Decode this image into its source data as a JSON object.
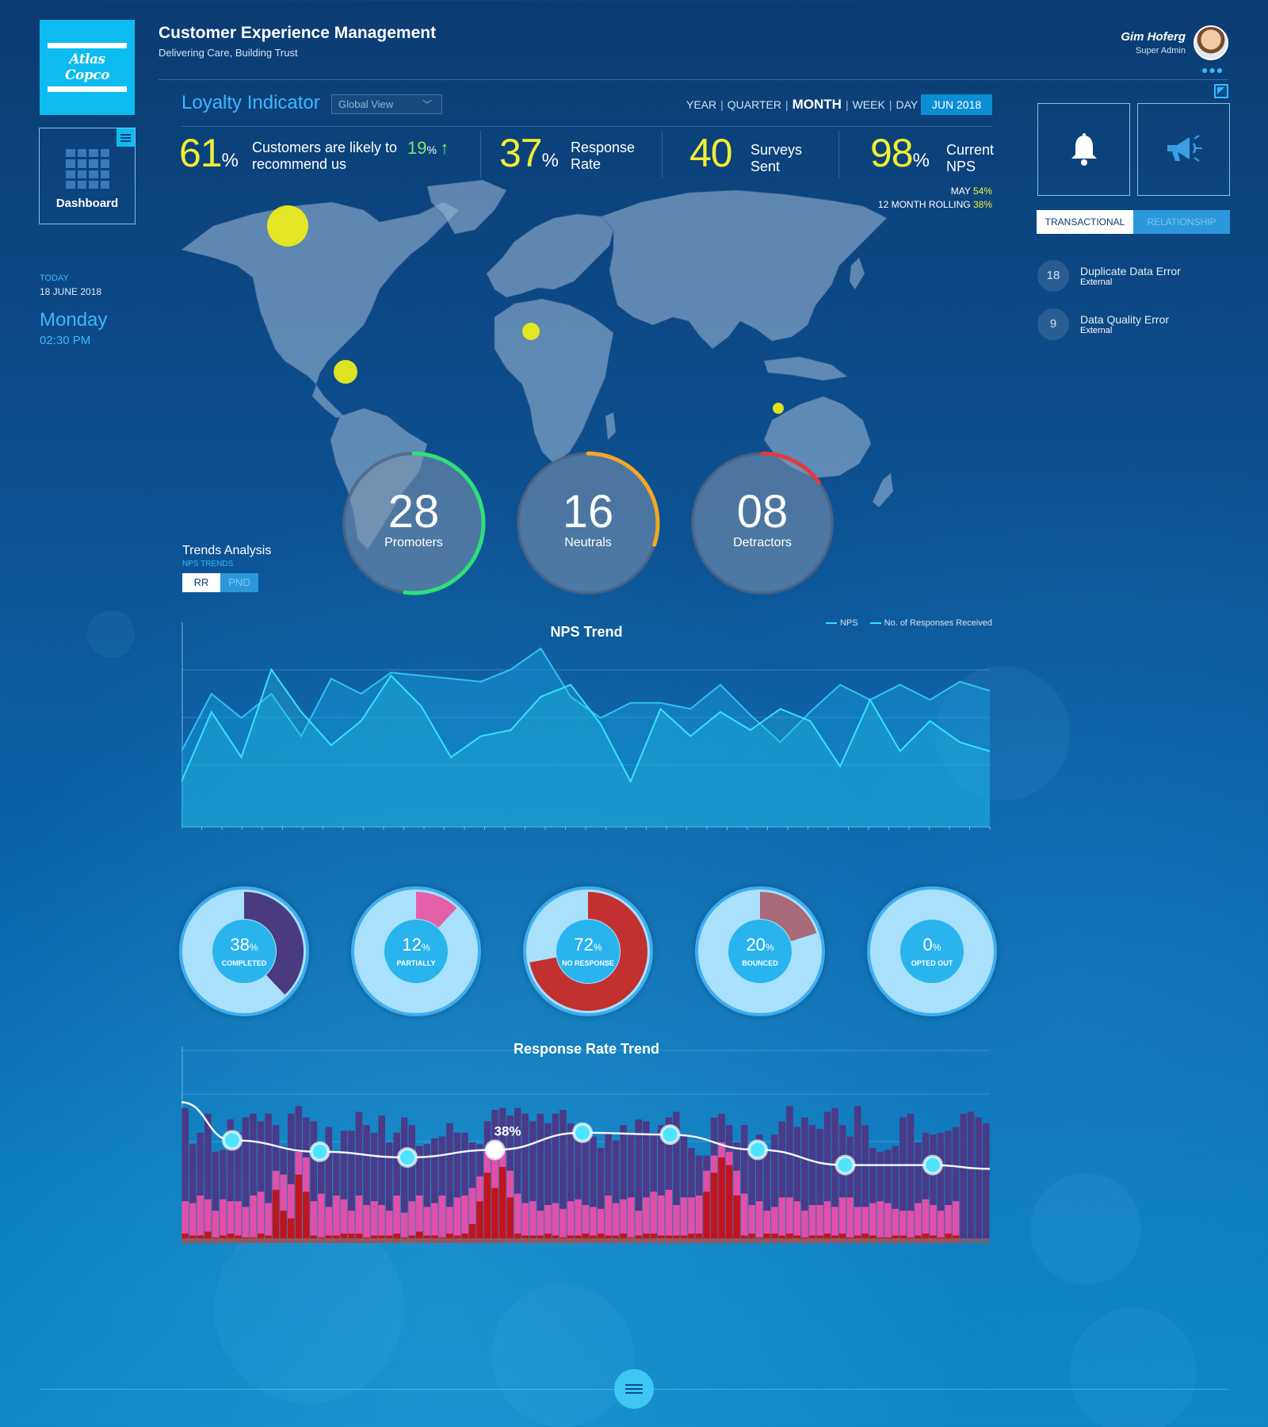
{
  "brand": {
    "logo_text": "Atlas Copco"
  },
  "header": {
    "title": "Customer Experience Management",
    "subtitle": "Delivering Care, Building Trust"
  },
  "user": {
    "name": "Gim Hoferg",
    "role": "Super Admin"
  },
  "sidebar": {
    "dashboard_label": "Dashboard"
  },
  "today": {
    "label": "TODAY",
    "date": "18 JUNE 2018",
    "day": "Monday",
    "time": "02:30 PM"
  },
  "loyalty": {
    "title": "Loyalty Indicator",
    "view_select": "Global View"
  },
  "periods": {
    "year": "YEAR",
    "quarter": "QUARTER",
    "month": "MONTH",
    "week": "WEEK",
    "day": "DAY",
    "selected": "JUN 2018"
  },
  "kpis": {
    "recommend": {
      "value": "61",
      "unit": "%",
      "label1": "Customers are likely to",
      "label2": "recommend us",
      "change": "19",
      "change_unit": "%",
      "arrow": "↑"
    },
    "response": {
      "value": "37",
      "unit": "%",
      "label1": "Response",
      "label2": "Rate"
    },
    "surveys": {
      "value": "40",
      "label1": "Surveys",
      "label2": "Sent"
    },
    "nps": {
      "value": "98",
      "unit": "%",
      "label1": "Current",
      "label2": "NPS"
    },
    "may_label": "MAY",
    "may_value": "54%",
    "rolling_label": "12 MONTH  ROLLING",
    "rolling_value": "38%"
  },
  "right": {
    "bell_icon": "bell-icon",
    "megaphone_icon": "megaphone-icon",
    "tab_transactional": "TRANSACTIONAL",
    "tab_relationship": "RELATIONSHIP",
    "alerts": [
      {
        "count": "18",
        "title": "Duplicate Data Error",
        "source": "External"
      },
      {
        "count": "9",
        "title": "Data Quality Error",
        "source": "External"
      }
    ]
  },
  "segments": [
    {
      "value": "28",
      "label": "Promoters",
      "ring_color": "#2ee07a",
      "fraction": 0.52
    },
    {
      "value": "16",
      "label": "Neutrals",
      "ring_color": "#f5a623",
      "fraction": 0.3
    },
    {
      "value": "08",
      "label": "Detractors",
      "ring_color": "#e23b3b",
      "fraction": 0.15
    }
  ],
  "trends": {
    "title": "Trends Analysis",
    "subtitle": "NPS TRENDS",
    "tab_rr": "RR",
    "tab_pnd": "PND"
  },
  "nps_chart": {
    "title": "NPS Trend",
    "legend_nps": "NPS",
    "legend_responses": "No. of Responses Received"
  },
  "chart_data": [
    {
      "type": "line",
      "title": "NPS Trend",
      "series": [
        {
          "name": "NPS",
          "values": [
            45,
            64,
            56,
            64,
            50,
            69,
            64,
            71,
            70,
            69,
            68,
            72,
            79,
            63,
            56,
            61,
            61,
            59,
            67,
            57,
            48,
            58,
            67,
            62,
            67,
            62,
            68,
            65
          ]
        },
        {
          "name": "No. of Responses Received",
          "values": [
            35,
            58,
            43,
            72,
            58,
            47,
            55,
            70,
            60,
            43,
            50,
            52,
            63,
            67,
            54,
            35,
            59,
            50,
            58,
            52,
            59,
            55,
            40,
            62,
            45,
            55,
            48,
            45
          ]
        }
      ]
    },
    {
      "type": "bar",
      "title": "Response Rate Trend",
      "annotation": "38%",
      "trend_line": [
        54,
        48,
        45,
        49,
        58,
        57,
        49,
        41,
        41
      ],
      "series": [
        {
          "name": "dark",
          "values": [
            71,
            52,
            58,
            68,
            48,
            49,
            65,
            58,
            66,
            68,
            64,
            68,
            62,
            51,
            68,
            72,
            66,
            64,
            52,
            61,
            48,
            59,
            59,
            69,
            62,
            58,
            67,
            53,
            58,
            66,
            62,
            51,
            52,
            55,
            56,
            63,
            58,
            58,
            53,
            52,
            64,
            70,
            71,
            67,
            71,
            68,
            64,
            68,
            63,
            68,
            70,
            63,
            58,
            54,
            56,
            50,
            58,
            54,
            62,
            57,
            65,
            64,
            58,
            62,
            66,
            69,
            56,
            50,
            46,
            46,
            66,
            68,
            62,
            53,
            62,
            49,
            57,
            49,
            57,
            64,
            72,
            61,
            66,
            62,
            60,
            69,
            71,
            62,
            56,
            72,
            62,
            50,
            48,
            49,
            51,
            66,
            68,
            53,
            58,
            57,
            58,
            59,
            61,
            68,
            69,
            66,
            63
          ]
        },
        {
          "name": "pink",
          "values": [
            22,
            21,
            25,
            23,
            17,
            23,
            22,
            22,
            19,
            25,
            27,
            21,
            38,
            36,
            31,
            48,
            45,
            22,
            26,
            19,
            25,
            23,
            17,
            25,
            20,
            22,
            20,
            17,
            25,
            16,
            22,
            25,
            19,
            21,
            25,
            19,
            24,
            25,
            29,
            35,
            48,
            45,
            50,
            38,
            26,
            21,
            22,
            17,
            20,
            21,
            18,
            22,
            23,
            20,
            19,
            18,
            25,
            21,
            23,
            24,
            17,
            24,
            27,
            25,
            28,
            20,
            24,
            24,
            25,
            38,
            46,
            53,
            48,
            38,
            26,
            20,
            22,
            17,
            19,
            24,
            24,
            22,
            17,
            20,
            20,
            22,
            19,
            24,
            24,
            19,
            19,
            21,
            22,
            21,
            18,
            17,
            17,
            21,
            23,
            20,
            17,
            20,
            22
          ]
        },
        {
          "name": "red",
          "values": [
            5,
            4,
            4,
            6,
            3,
            4,
            5,
            4,
            3,
            3,
            5,
            4,
            28,
            17,
            13,
            36,
            27,
            4,
            3,
            4,
            4,
            5,
            5,
            5,
            3,
            4,
            4,
            4,
            5,
            3,
            4,
            6,
            4,
            4,
            3,
            5,
            4,
            5,
            10,
            22,
            37,
            29,
            40,
            24,
            5,
            4,
            4,
            4,
            5,
            4,
            3,
            4,
            4,
            5,
            4,
            5,
            4,
            4,
            5,
            3,
            4,
            5,
            5,
            4,
            4,
            4,
            4,
            5,
            5,
            27,
            37,
            45,
            41,
            25,
            4,
            5,
            3,
            5,
            5,
            4,
            5,
            4,
            3,
            4,
            4,
            5,
            4,
            5,
            3,
            4,
            5,
            4,
            3,
            3,
            4,
            4,
            3,
            4,
            5,
            4,
            3,
            5,
            4
          ]
        }
      ]
    }
  ],
  "statuses": [
    {
      "value": "38",
      "unit": "%",
      "label": "COMPLETED",
      "fraction": 0.38,
      "color": "#4a3a80"
    },
    {
      "value": "12",
      "unit": "%",
      "label": "PARTIALLY",
      "fraction": 0.12,
      "color": "#e35fa8"
    },
    {
      "value": "72",
      "unit": "%",
      "label": "NO RESPONSE",
      "fraction": 0.72,
      "color": "#c23030"
    },
    {
      "value": "20",
      "unit": "%",
      "label": "BOUNCED",
      "fraction": 0.2,
      "color": "#a86a78"
    },
    {
      "value": "0",
      "unit": "%",
      "label": "OPTED OUT",
      "fraction": 0.0,
      "color": "#4a3a80"
    }
  ]
}
